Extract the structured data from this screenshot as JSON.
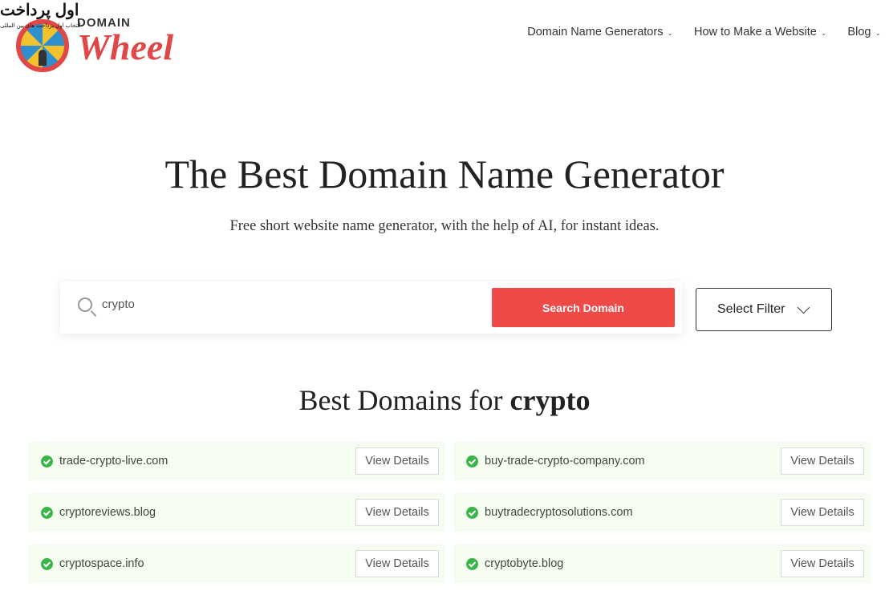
{
  "logo": {
    "domain": "DOMAIN",
    "wheel": "Wheel",
    "watermark": "اول پرداخت",
    "watermark_sub": "انتخاب اول پرداخت های بین المللی"
  },
  "nav": [
    {
      "label": "Domain Name Generators"
    },
    {
      "label": "How to Make a Website"
    },
    {
      "label": "Blog"
    }
  ],
  "hero": {
    "title": "The Best Domain Name Generator",
    "subtitle": "Free short website name generator, with the help of AI, for instant ideas."
  },
  "search": {
    "value": "crypto",
    "button": "Search Domain",
    "filter": "Select Filter"
  },
  "results": {
    "prefix": "Best Domains for",
    "keyword": "crypto",
    "button": "View Details",
    "items": [
      {
        "name": "trade-crypto-live.com"
      },
      {
        "name": "buy-trade-crypto-company.com"
      },
      {
        "name": "cryptoreviews.blog"
      },
      {
        "name": "buytradecryptosolutions.com"
      },
      {
        "name": "cryptospace.info"
      },
      {
        "name": "cryptobyte.blog"
      }
    ]
  },
  "colors": {
    "accent": "#ee4a47",
    "available": "#3bb54a",
    "row_bg": "#f5fdf0"
  }
}
